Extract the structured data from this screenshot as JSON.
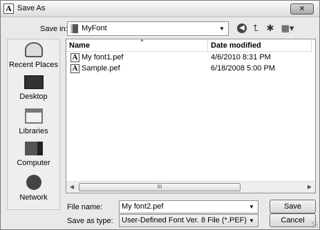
{
  "window": {
    "title": "Save As",
    "close_glyph": "✕",
    "app_icon_letter": "A"
  },
  "toolbar": {
    "save_in_label": "Save in:",
    "save_in_value": "MyFont",
    "icons": [
      "back-icon",
      "up-folder-icon",
      "new-folder-icon",
      "views-menu-icon"
    ]
  },
  "places": [
    {
      "label": "Recent Places",
      "icon": "recent-places-icon"
    },
    {
      "label": "Desktop",
      "icon": "desktop-icon"
    },
    {
      "label": "Libraries",
      "icon": "libraries-icon"
    },
    {
      "label": "Computer",
      "icon": "computer-icon"
    },
    {
      "label": "Network",
      "icon": "network-icon"
    }
  ],
  "filelist": {
    "headers": {
      "name": "Name",
      "date": "Date modified"
    },
    "files": [
      {
        "name": "My font1.pef",
        "date": "4/6/2010 8:31 PM"
      },
      {
        "name": "Sample.pef",
        "date": "6/18/2008 5:00 PM"
      }
    ],
    "scroll_thumb_glyph": "III"
  },
  "form": {
    "file_name_label": "File name:",
    "file_name_value": "My font2.pef",
    "save_type_label": "Save as type:",
    "save_type_value": "User-Defined Font Ver. 8 File (*.PEF)",
    "save_button": "Save",
    "cancel_button": "Cancel"
  },
  "colors": {
    "window_bg": "#e9e9e9",
    "list_bg": "#ffffff"
  }
}
